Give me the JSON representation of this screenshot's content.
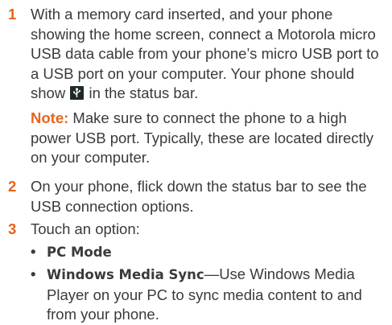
{
  "steps": [
    {
      "number": "1",
      "text_before_icon": "With a memory card inserted, and your phone showing the home screen, connect a Motorola micro USB data cable from your phone’s micro USB port to a USB port on your computer. Your phone should show",
      "text_after_icon": " in the status bar.",
      "icon": "usb-connected-icon"
    },
    {
      "note_label": "Note:",
      "note_text": " Make sure to connect the phone to a high power USB port. Typically, these are located directly on your computer."
    },
    {
      "number": "2",
      "text": "On your phone, flick down the status bar to see the USB connection options."
    },
    {
      "number": "3",
      "text": "Touch an option:"
    }
  ],
  "options": [
    {
      "bullet": "•",
      "title": "PC Mode",
      "description": ""
    },
    {
      "bullet": "•",
      "title": "Windows Media Sync",
      "description": "—Use Windows Media Player on your PC to sync media content to and from your phone."
    }
  ],
  "colors": {
    "accent": "#e8641b",
    "text": "#3a3a3a"
  }
}
